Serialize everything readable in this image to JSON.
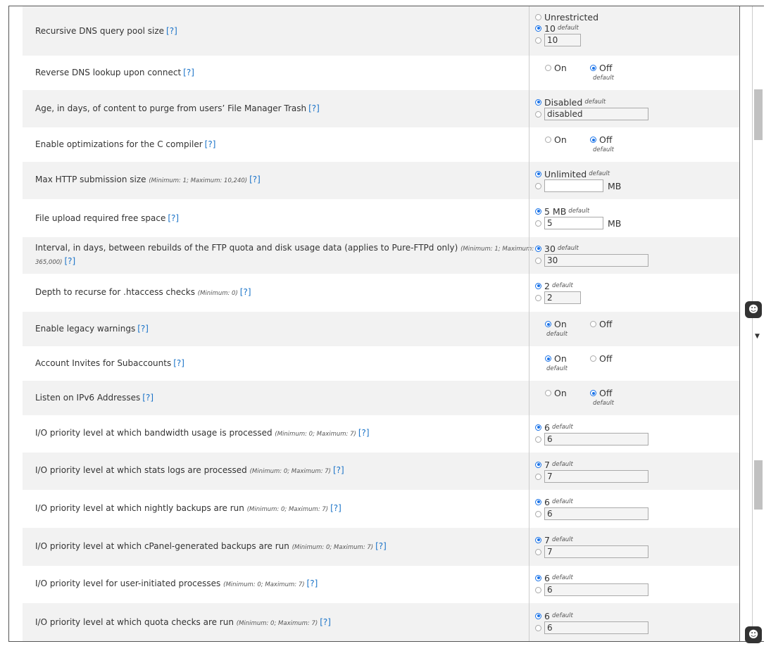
{
  "settings": [
    {
      "label": "Recursive DNS query pool size",
      "hint": "",
      "help": "[?]",
      "kind": "three",
      "opt1": "Unrestricted",
      "opt2": "10",
      "default_label": "default",
      "input": "10"
    },
    {
      "label": "Reverse DNS lookup upon connect",
      "hint": "",
      "help": "[?]",
      "kind": "onoff",
      "on": "On",
      "off": "Off",
      "selected": "off",
      "default_label": "default"
    },
    {
      "label": "Age, in days, of content to purge from users’ File Manager Trash",
      "hint": "",
      "help": "[?]",
      "kind": "two",
      "opt1": "Disabled",
      "default_label": "default",
      "input": "disabled",
      "unit": ""
    },
    {
      "label": "Enable optimizations for the C compiler",
      "hint": "",
      "help": "[?]",
      "kind": "onoff",
      "on": "On",
      "off": "Off",
      "selected": "off",
      "default_label": "default"
    },
    {
      "label": "Max HTTP submission size",
      "hint": "(Minimum: 1; Maximum: 10,240)",
      "help": "[?]",
      "kind": "two",
      "opt1": "Unlimited",
      "default_label": "default",
      "input": "",
      "unit": "MB"
    },
    {
      "label": "File upload required free space",
      "hint": "",
      "help": "[?]",
      "kind": "two",
      "opt1": "5 MB",
      "default_label": "default",
      "input": "5",
      "unit": "MB"
    },
    {
      "label": "Interval, in days, between rebuilds of the FTP quota and disk usage data (applies to Pure-FTPd only)",
      "hint": "(Minimum: 1; Maximum: 365,000)",
      "help": "[?]",
      "kind": "two",
      "opt1": "30",
      "default_label": "default",
      "input": "30",
      "unit": ""
    },
    {
      "label": "Depth to recurse for .htaccess checks",
      "hint": "(Minimum: 0)",
      "help": "[?]",
      "kind": "two-short",
      "opt1": "2",
      "default_label": "default",
      "input": "2",
      "unit": ""
    },
    {
      "label": "Enable legacy warnings",
      "hint": "",
      "help": "[?]",
      "kind": "onoff",
      "on": "On",
      "off": "Off",
      "selected": "on",
      "default_label": "default"
    },
    {
      "label": "Account Invites for Subaccounts",
      "hint": "",
      "help": "[?]",
      "kind": "onoff",
      "on": "On",
      "off": "Off",
      "selected": "on",
      "default_label": "default"
    },
    {
      "label": "Listen on IPv6 Addresses",
      "hint": "",
      "help": "[?]",
      "kind": "onoff",
      "on": "On",
      "off": "Off",
      "selected": "off",
      "default_label": "default"
    },
    {
      "label": "I/O priority level at which bandwidth usage is processed",
      "hint": "(Minimum: 0; Maximum: 7)",
      "help": "[?]",
      "kind": "two",
      "opt1": "6",
      "default_label": "default",
      "input": "6",
      "unit": ""
    },
    {
      "label": "I/O priority level at which stats logs are processed",
      "hint": "(Minimum: 0; Maximum: 7)",
      "help": "[?]",
      "kind": "two",
      "opt1": "7",
      "default_label": "default",
      "input": "7",
      "unit": ""
    },
    {
      "label": "I/O priority level at which nightly backups are run",
      "hint": "(Minimum: 0; Maximum: 7)",
      "help": "[?]",
      "kind": "two",
      "opt1": "6",
      "default_label": "default",
      "input": "6",
      "unit": ""
    },
    {
      "label": "I/O priority level at which cPanel-generated backups are run",
      "hint": "(Minimum: 0; Maximum: 7)",
      "help": "[?]",
      "kind": "two",
      "opt1": "7",
      "default_label": "default",
      "input": "7",
      "unit": ""
    },
    {
      "label": "I/O priority level for user-initiated processes",
      "hint": "(Minimum: 0; Maximum: 7)",
      "help": "[?]",
      "kind": "two",
      "opt1": "6",
      "default_label": "default",
      "input": "6",
      "unit": ""
    },
    {
      "label": "I/O priority level at which quota checks are run",
      "hint": "(Minimum: 0; Maximum: 7)",
      "help": "[?]",
      "kind": "two",
      "opt1": "6",
      "default_label": "default",
      "input": "6",
      "unit": ""
    }
  ],
  "icons": {
    "chat": "chat-bubble-icon",
    "caret": "caret-down-icon"
  },
  "colors": {
    "accent": "#1a73e8",
    "link": "#1a73c8",
    "row_alt": "#f2f2f2"
  }
}
